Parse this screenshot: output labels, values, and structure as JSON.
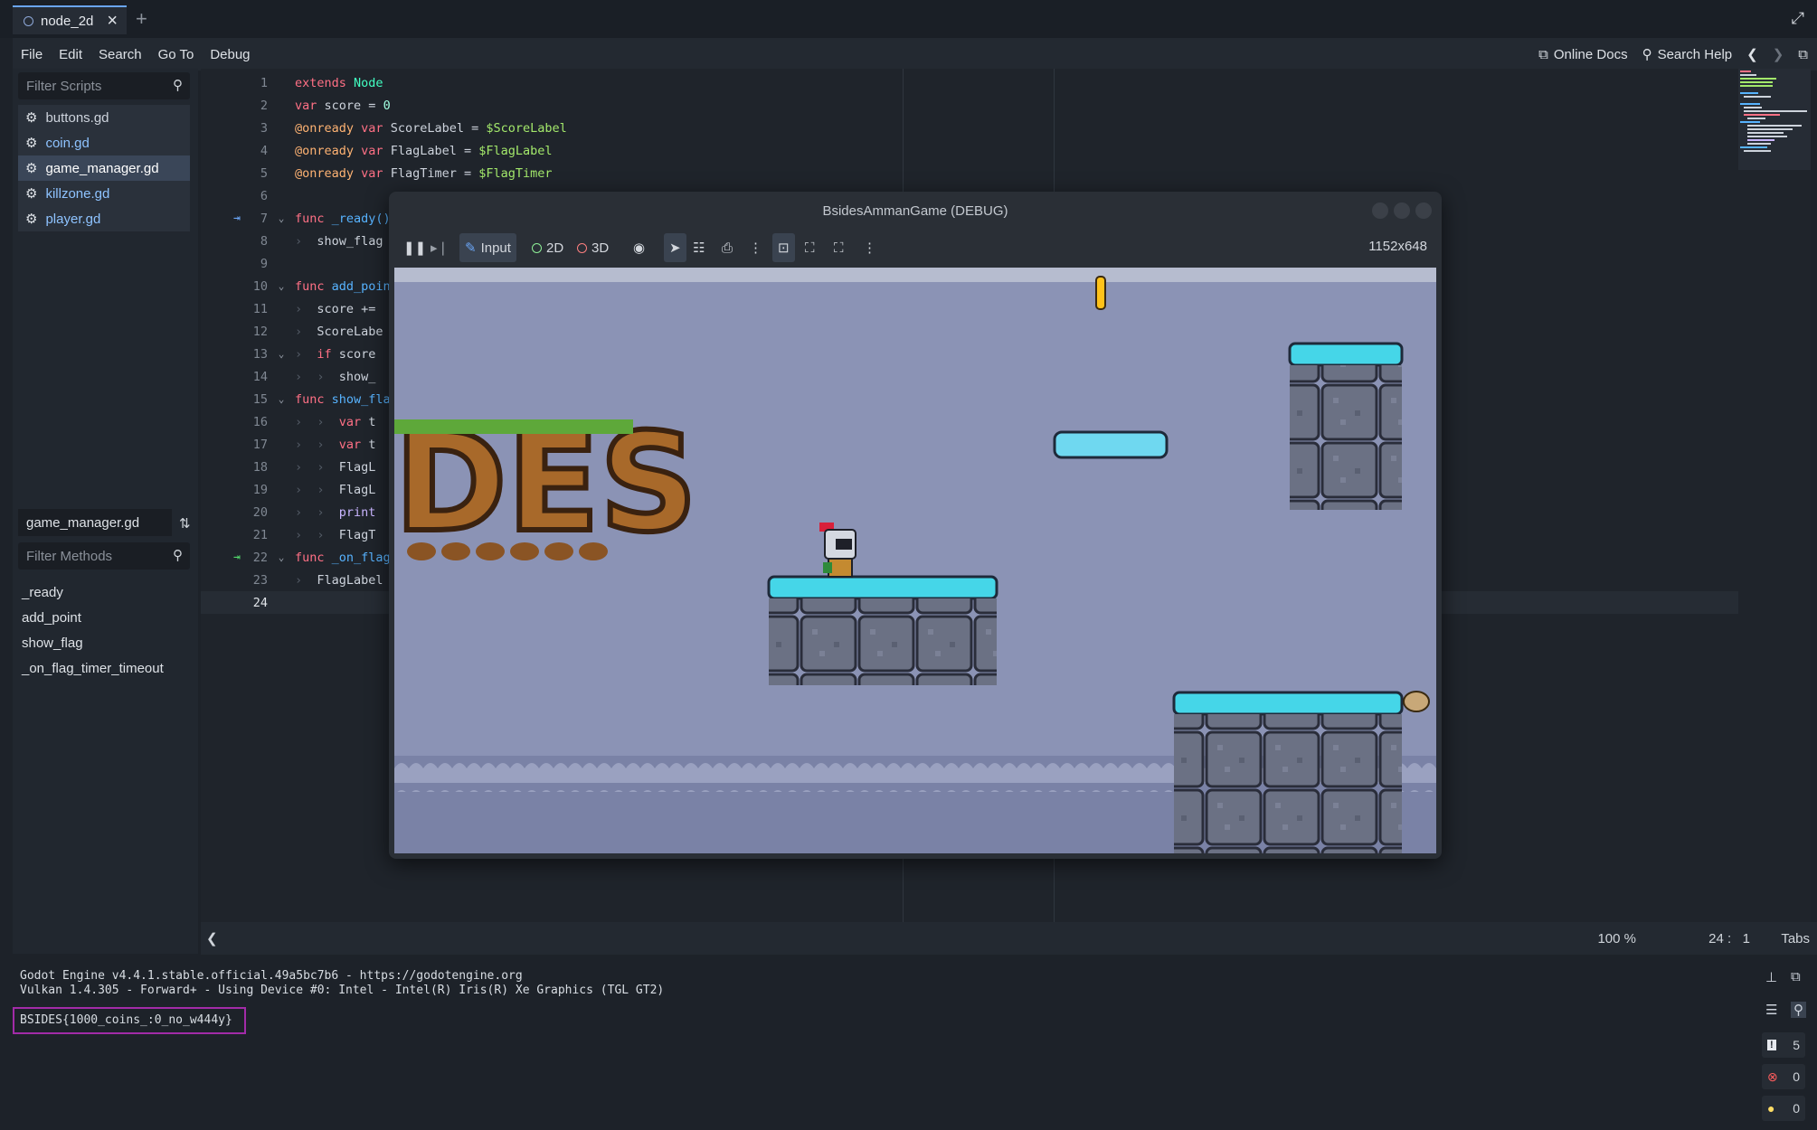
{
  "tab": {
    "name": "node_2d"
  },
  "menu": {
    "items": [
      "File",
      "Edit",
      "Search",
      "Go To",
      "Debug"
    ],
    "online_docs": "Online Docs",
    "search_help": "Search Help"
  },
  "left_panel": {
    "filter_scripts_placeholder": "Filter Scripts",
    "scripts": [
      "buttons.gd",
      "coin.gd",
      "game_manager.gd",
      "killzone.gd",
      "player.gd"
    ],
    "selected_script": "game_manager.gd",
    "current_script": "game_manager.gd",
    "filter_methods_placeholder": "Filter Methods",
    "methods": [
      "_ready",
      "add_point",
      "show_flag",
      "_on_flag_timer_timeout"
    ]
  },
  "editor": {
    "line_numbers": [
      "1",
      "2",
      "3",
      "4",
      "5",
      "6",
      "7",
      "8",
      "9",
      "10",
      "11",
      "12",
      "13",
      "14",
      "15",
      "16",
      "17",
      "18",
      "19",
      "20",
      "21",
      "22",
      "23",
      "24"
    ],
    "lines": {
      "l1": {
        "a": "extends",
        "b": "Node"
      },
      "l2": {
        "a": "var",
        "b": "score = ",
        "c": "0"
      },
      "l3": {
        "a": "@onready",
        "b": "var",
        "c": "ScoreLabel = ",
        "d": "$ScoreLabel"
      },
      "l4": {
        "a": "@onready",
        "b": "var",
        "c": "FlagLabel = ",
        "d": "$FlagLabel"
      },
      "l5": {
        "a": "@onready",
        "b": "var",
        "c": "FlagTimer = ",
        "d": "$FlagTimer"
      },
      "l7": {
        "a": "func",
        "b": "_ready()"
      },
      "l8": {
        "a": "show_flag"
      },
      "l10": {
        "a": "func",
        "b": "add_poin"
      },
      "l11": {
        "a": "score +="
      },
      "l12": {
        "a": "ScoreLabe"
      },
      "l13": {
        "a": "if",
        "b": "score"
      },
      "l14": {
        "a": "show_"
      },
      "l15": {
        "a": "func",
        "b": "show_fla"
      },
      "l16": {
        "a": "var",
        "b": "t"
      },
      "l17": {
        "a": "var",
        "b": "t"
      },
      "l18": {
        "a": "FlagL"
      },
      "l19": {
        "a": "FlagL"
      },
      "l20": {
        "a": "print"
      },
      "l21": {
        "a": "FlagT"
      },
      "l22": {
        "a": "func",
        "b": "_on_flag"
      },
      "l23": {
        "a": "FlagLabel"
      }
    }
  },
  "status": {
    "zoom": "100 %",
    "line": "24",
    "col": "1",
    "indent": "Tabs"
  },
  "output": {
    "line1": "Godot Engine v4.4.1.stable.official.49a5bc7b6 - https://godotengine.org",
    "line2": "Vulkan 1.4.305 - Forward+ - Using Device #0: Intel - Intel(R) Iris(R) Xe Graphics (TGL GT2)",
    "flag": "BSIDES{1000_coins_:0_no_w444y}",
    "counts": {
      "messages": "5",
      "errors": "0",
      "warnings": "0"
    }
  },
  "game": {
    "window_title": "BsidesAmmanGame (DEBUG)",
    "input_label": "Input",
    "label_2d": "2D",
    "label_3d": "3D",
    "resolution": "1152x648",
    "logo_text": "DES"
  },
  "colors": {
    "accent": "#6aa5f5",
    "flag_box": "#a22ba8"
  }
}
